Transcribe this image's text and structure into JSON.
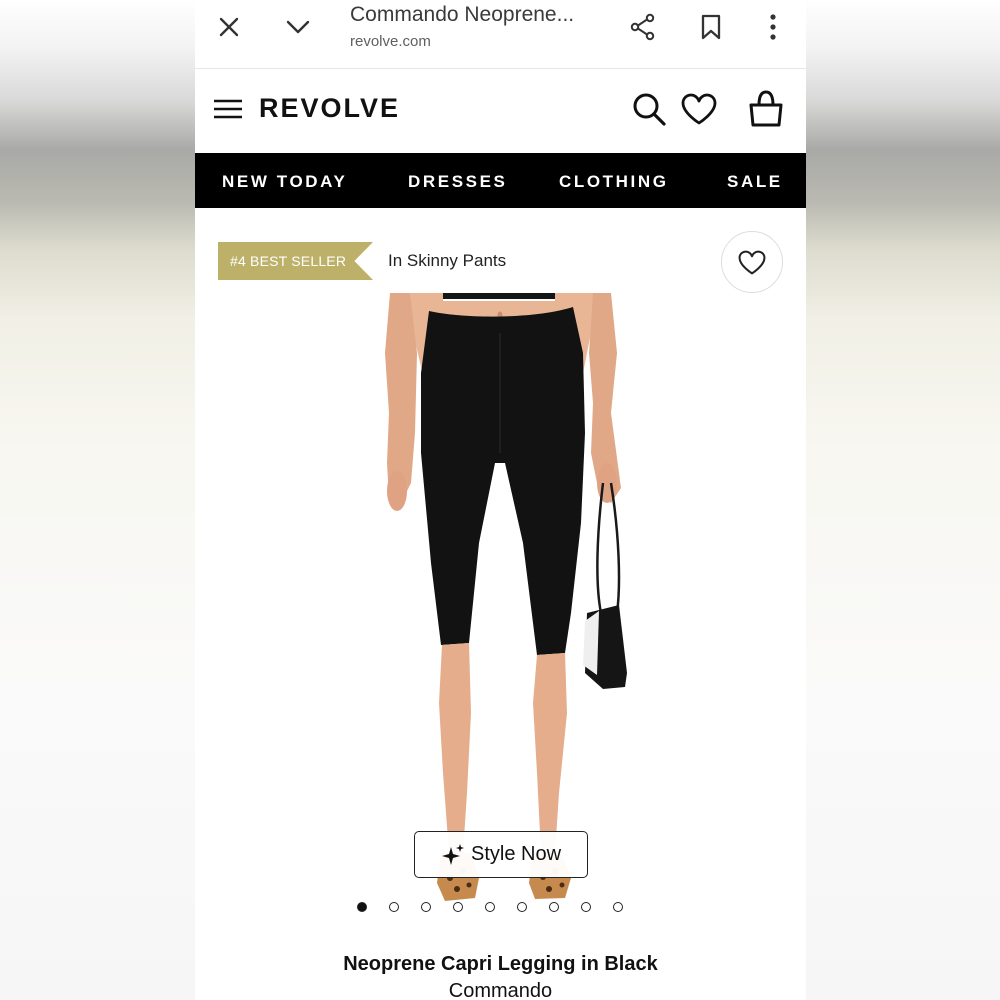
{
  "browser": {
    "title": "Commando Neoprene...",
    "url": "revolve.com",
    "icons": [
      "close-icon",
      "chevron-down-icon",
      "share-icon",
      "bookmark-icon",
      "more-vert-icon"
    ]
  },
  "header": {
    "logo": "REVOLVE",
    "icons": [
      "menu-icon",
      "search-icon",
      "heart-icon",
      "shopping-bag-icon"
    ]
  },
  "nav": {
    "items": [
      "NEW TODAY",
      "DRESSES",
      "CLOTHING",
      "SALE"
    ]
  },
  "product": {
    "badge": "#4 BEST SELLER",
    "category": "In Skinny Pants",
    "style_now": "Style Now",
    "image_count": 9,
    "active_image": 1,
    "name": "Neoprene Capri Legging in Black",
    "brand": "Commando"
  },
  "colors": {
    "badge": "#bdb16a",
    "nav_bg": "#000000",
    "text": "#111111"
  }
}
